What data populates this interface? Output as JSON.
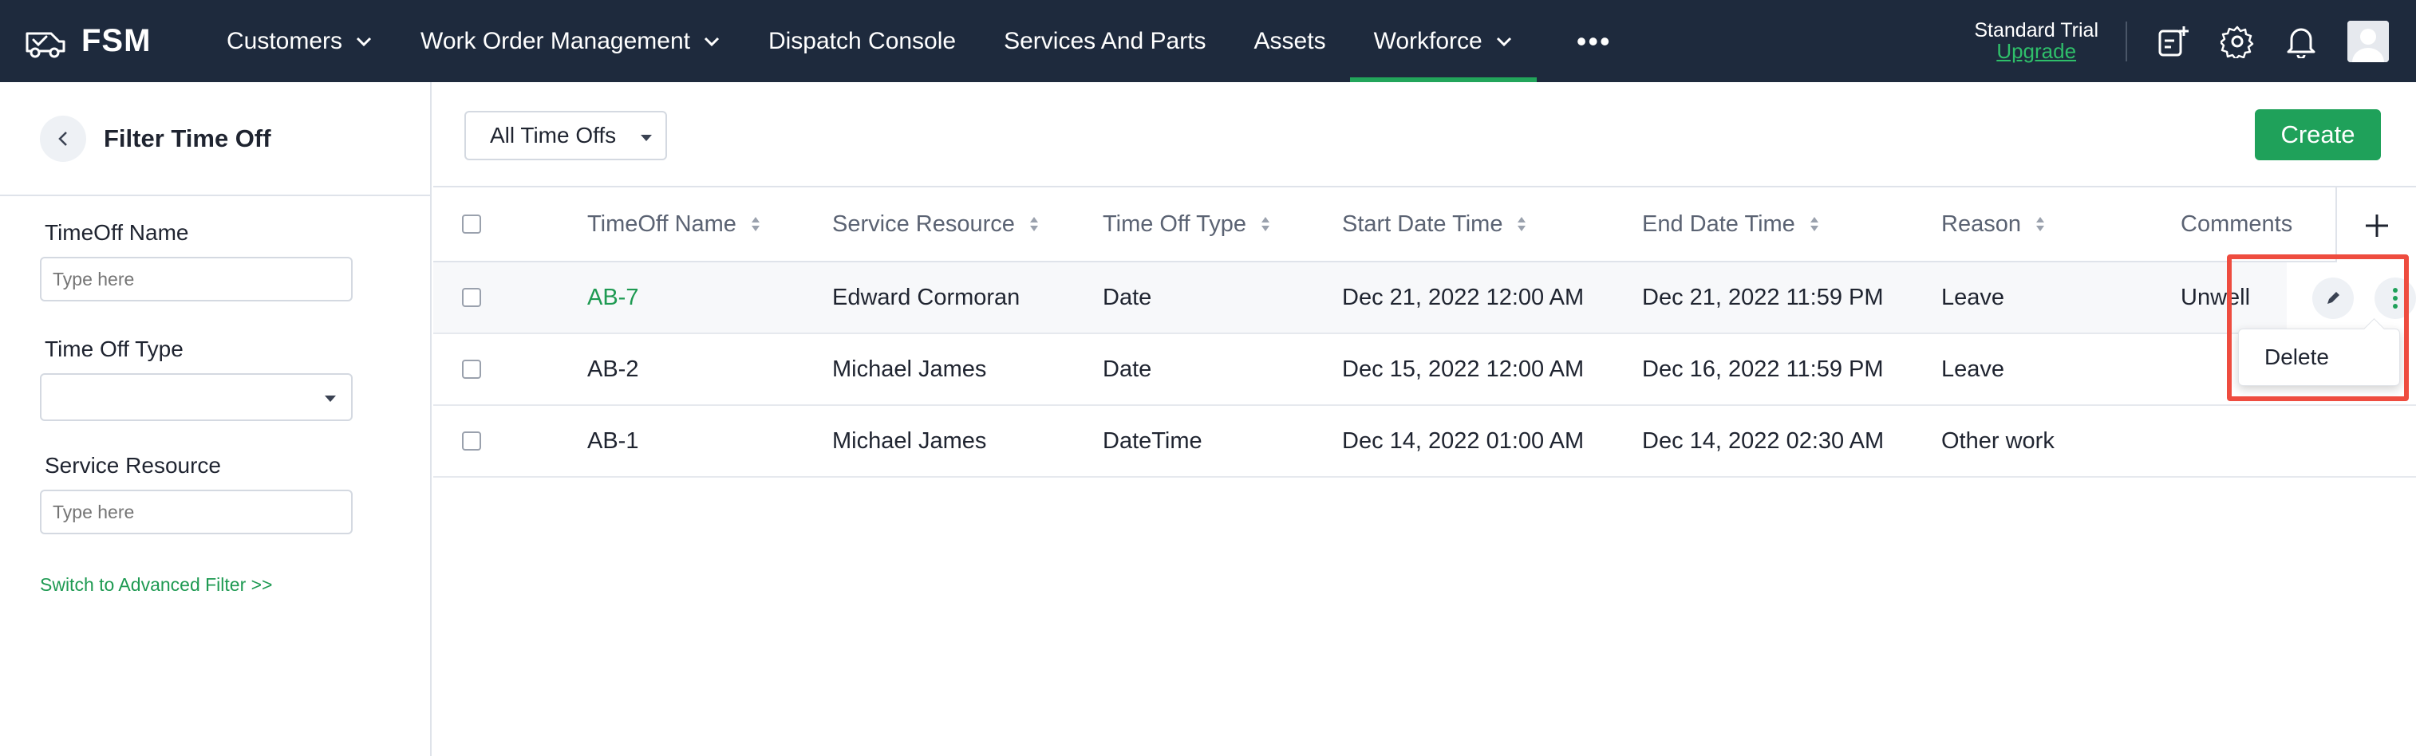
{
  "brand": {
    "name": "FSM"
  },
  "nav": {
    "items": [
      {
        "label": "Customers",
        "dropdown": true,
        "active": false
      },
      {
        "label": "Work Order Management",
        "dropdown": true,
        "active": false
      },
      {
        "label": "Dispatch Console",
        "dropdown": false,
        "active": false
      },
      {
        "label": "Services And Parts",
        "dropdown": false,
        "active": false
      },
      {
        "label": "Assets",
        "dropdown": false,
        "active": false
      },
      {
        "label": "Workforce",
        "dropdown": true,
        "active": true
      }
    ],
    "more": "•••",
    "trial_label": "Standard Trial",
    "upgrade_label": "Upgrade"
  },
  "sidebar": {
    "title": "Filter Time Off",
    "filters": {
      "timeoff_name_label": "TimeOff Name",
      "timeoff_name_placeholder": "Type here",
      "time_off_type_label": "Time Off Type",
      "service_resource_label": "Service Resource",
      "service_resource_placeholder": "Type here"
    },
    "advanced_link": "Switch to Advanced Filter >>"
  },
  "toolbar": {
    "view": "All Time Offs",
    "create_label": "Create"
  },
  "table": {
    "columns": [
      "TimeOff Name",
      "Service Resource",
      "Time Off Type",
      "Start Date Time",
      "End Date Time",
      "Reason",
      "Comments"
    ],
    "rows": [
      {
        "name": "AB-7",
        "resource": "Edward Cormoran",
        "type": "Date",
        "start": "Dec 21, 2022 12:00 AM",
        "end": "Dec 21, 2022 11:59 PM",
        "reason": "Leave",
        "comments": "Unwell"
      },
      {
        "name": "AB-2",
        "resource": "Michael James",
        "type": "Date",
        "start": "Dec 15, 2022 12:00 AM",
        "end": "Dec 16, 2022 11:59 PM",
        "reason": "Leave",
        "comments": ""
      },
      {
        "name": "AB-1",
        "resource": "Michael James",
        "type": "DateTime",
        "start": "Dec 14, 2022 01:00 AM",
        "end": "Dec 14, 2022 02:30 AM",
        "reason": "Other work",
        "comments": ""
      }
    ]
  },
  "row_menu": {
    "delete_label": "Delete"
  },
  "colors": {
    "nav_bg": "#1e2a3d",
    "accent_green": "#1fa15a",
    "highlight_red": "#ee4c3f"
  }
}
